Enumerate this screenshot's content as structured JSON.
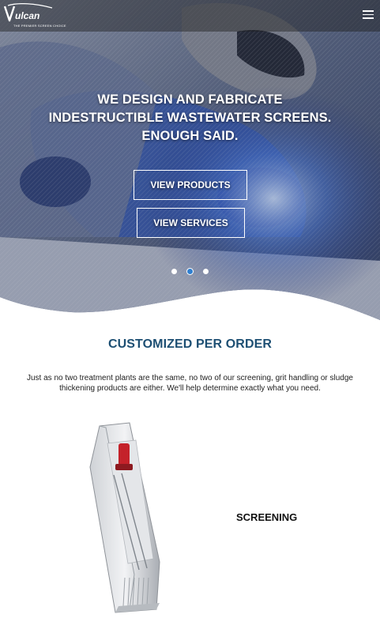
{
  "header": {
    "logo_text": "Vulcan",
    "logo_tagline": "THE PREMIER SCREEN CHOICE",
    "menu_icon": "hamburger-menu-icon"
  },
  "hero": {
    "headline_line1": "WE DESIGN AND FABRICATE",
    "headline_line2": "INDESTRUCTIBLE WASTEWATER SCREENS.",
    "headline_line3": "ENOUGH SAID.",
    "button_products": "VIEW PRODUCTS",
    "button_services": "VIEW SERVICES",
    "slides": 3,
    "active_slide": 2
  },
  "section": {
    "title": "CUSTOMIZED PER ORDER",
    "description": "Just as no two treatment plants are the same, no two of our screening, grit handling or sludge thickening products are either. We'll help determine exactly what you need."
  },
  "product": {
    "label": "SCREENING"
  },
  "colors": {
    "title_blue": "#1d4f73",
    "dot_active": "#2f7fd0"
  }
}
